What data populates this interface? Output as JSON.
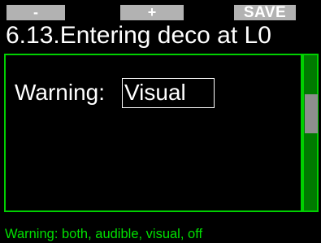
{
  "softkeys": {
    "minus_label": "-",
    "plus_label": "+",
    "save_label": "SAVE"
  },
  "title": "6.13.Entering deco at L0",
  "setting": {
    "label": "Warning:",
    "value": "Visual"
  },
  "hint": "Warning: both, audible, visual, off",
  "colors": {
    "background": "#000000",
    "softkey": "#b2b2b2",
    "panel_border": "#00d000",
    "scrollbar_track": "#007a00",
    "scrollbar_thumb": "#8e8e8e",
    "hint_text": "#00e000"
  }
}
